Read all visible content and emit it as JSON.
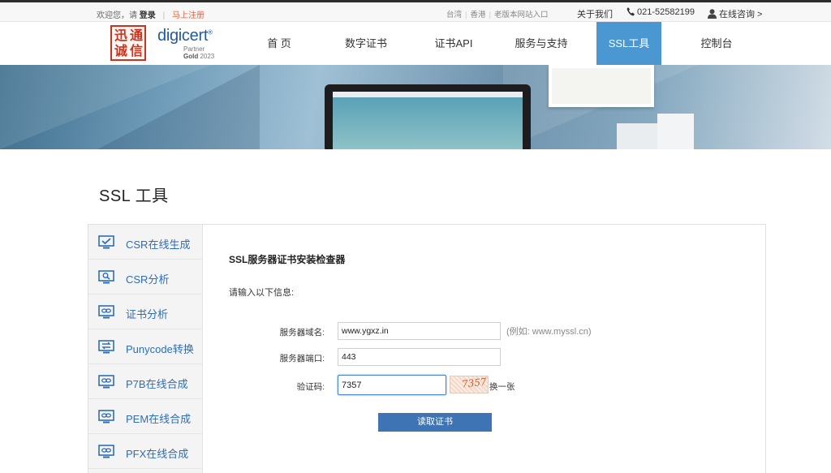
{
  "topbar": {
    "welcome": "欢迎您，请",
    "login": "登录",
    "separator": "|",
    "register": "马上注册",
    "region_taiwan": "台湾",
    "region_hongkong": "香港",
    "old_site": "老版本网站入口",
    "about": "关于我们",
    "phone": "021-52582199",
    "consult": "在线咨询 >"
  },
  "brand": {
    "seal_chars": [
      "迅",
      "通",
      "诚",
      "信"
    ],
    "digicert": "digicert",
    "registered": "®",
    "partner": "Partner",
    "gold": "Gold",
    "year": "2023"
  },
  "nav": {
    "items": [
      {
        "label": "首  页",
        "active": false
      },
      {
        "label": "数字证书",
        "active": false
      },
      {
        "label": "证书API",
        "active": false
      },
      {
        "label": "服务与支持",
        "active": false
      },
      {
        "label": "SSL工具",
        "active": true
      },
      {
        "label": "控制台",
        "active": false
      }
    ]
  },
  "page": {
    "title": "SSL 工具"
  },
  "sidebar": {
    "items": [
      {
        "label": "CSR在线生成",
        "icon": "monitor-check-icon"
      },
      {
        "label": "CSR分析",
        "icon": "magnifier-icon"
      },
      {
        "label": "证书分析",
        "icon": "link-icon"
      },
      {
        "label": "Punycode转换",
        "icon": "convert-icon"
      },
      {
        "label": "P7B在线合成",
        "icon": "link-icon"
      },
      {
        "label": "PEM在线合成",
        "icon": "link-icon"
      },
      {
        "label": "PFX在线合成",
        "icon": "link-icon"
      }
    ]
  },
  "form": {
    "title": "SSL服务器证书安装检查器",
    "subtitle": "请输入以下信息:",
    "domain_label": "服务器域名:",
    "domain_value": "www.ygxz.in",
    "domain_hint": "(例如:   www.myssl.cn)",
    "port_label": "服务器端口:",
    "port_value": "443",
    "captcha_label": "验证码:",
    "captcha_value": "7357",
    "captcha_image_text": "7357",
    "refresh": "换一张",
    "submit": "读取证书"
  },
  "colors": {
    "accent": "#4a97d2",
    "link": "#2f6db5",
    "button": "#3f74b4",
    "register": "#e8643c"
  }
}
